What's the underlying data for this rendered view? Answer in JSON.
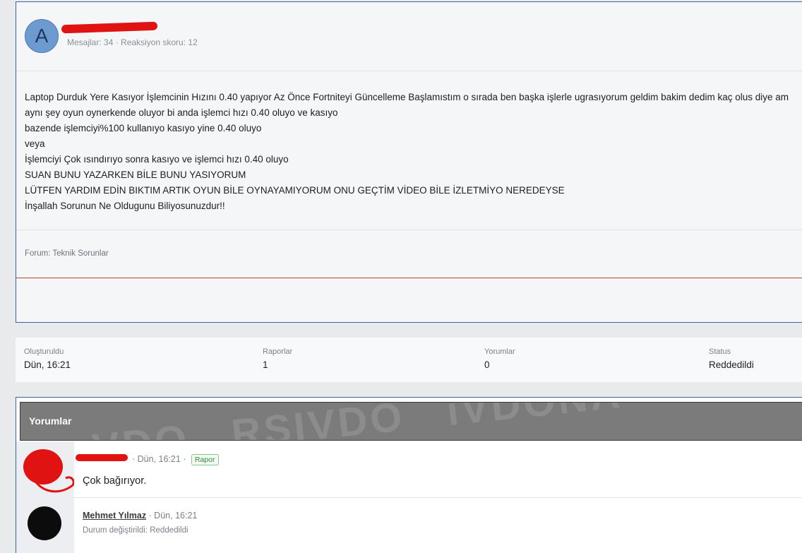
{
  "post": {
    "avatar_letter": "A",
    "user_stats": "Mesajlar: 34 · Reaksiyon skoru: 12",
    "body_lines": [
      "Laptop Durduk Yere Kasıyor İşlemcinin Hızını 0.40 yapıyor Az Önce Fortniteyi Güncelleme Başlamıstım o sırada ben başka işlerle ugrasıyorum geldim bakim dedim kaç olus diye am",
      "aynı şey oyun oynerkende oluyor bi anda işlemci hızı 0.40 oluyo ve kasıyo",
      "bazende işlemciyi%100 kullanıyo kasıyo yine 0.40 oluyo",
      "veya",
      "İşlemciyi Çok ısındırıyo sonra kasıyo ve işlemci hızı 0.40 oluyo",
      "SUAN BUNU YAZARKEN BİLE BUNU YASIYORUM",
      "LÜTFEN YARDIM EDİN BIKTIM ARTIK OYUN BİLE OYNAYAMIYORUM ONU GEÇTİM VİDEO BİLE İZLETMİYO NEREDEYSE",
      "İnşallah Sorunun Ne Oldugunu Biliyosunuzdur!!"
    ],
    "forum": "Forum: Teknik Sorunlar"
  },
  "info": {
    "created_label": "Oluşturuldu",
    "created_value": "Dün, 16:21",
    "reports_label": "Raporlar",
    "reports_value": "1",
    "comments_label": "Yorumlar",
    "comments_value": "0",
    "status_label": "Status",
    "status_value": "Reddedildi"
  },
  "comments": {
    "title": "Yorumlar",
    "items": [
      {
        "meta": "· Dün, 16:21 ·",
        "badge": "Rapor",
        "text": "Çok bağırıyor."
      },
      {
        "username": "Mehmet Yılmaz",
        "meta": " · Dün, 16:21",
        "sub": "Durum değiştirildi: Reddedildi"
      }
    ]
  },
  "colors": {
    "accent_border": "#3a64a8",
    "redaction": "#e01212",
    "badge_green": "#3b8a40"
  }
}
